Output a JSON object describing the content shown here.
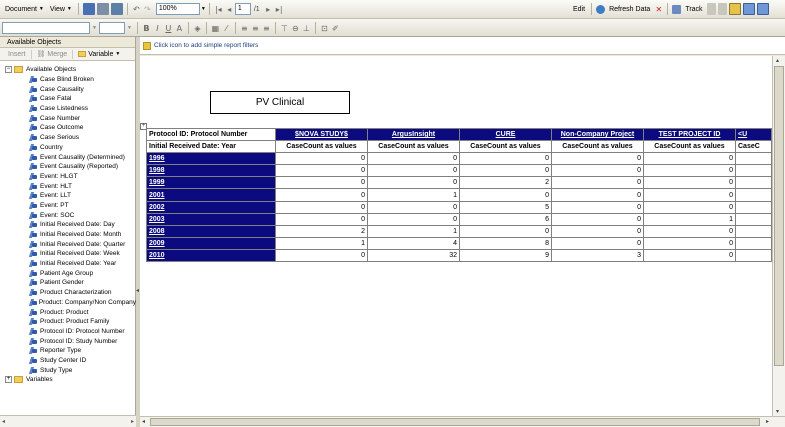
{
  "toolbar": {
    "document_label": "Document",
    "view_label": "View",
    "zoom_value": "100%",
    "page_value": "1",
    "page_of": "/1",
    "edit_label": "Edit",
    "refresh_label": "Refresh Data",
    "track_label": "Track"
  },
  "format_toolbar": {
    "font_value": "",
    "size_value": ""
  },
  "left_panel": {
    "title": "Available Objects",
    "insert_label": "Insert",
    "merge_label": "Merge",
    "variable_label": "Variable",
    "root_label": "Available Objects",
    "objects": [
      "Case Blind Broken",
      "Case Causality",
      "Case Fatal",
      "Case Listedness",
      "Case Number",
      "Case Outcome",
      "Case Serious",
      "Country",
      "Event Causality (Determined)",
      "Event Causality (Reported)",
      "Event: HLGT",
      "Event: HLT",
      "Event: LLT",
      "Event: PT",
      "Event: SOC",
      "Initial Received Date: Day",
      "Initial Received Date: Month",
      "Initial Received Date: Quarter",
      "Initial Received Date: Week",
      "Initial Received Date: Year",
      "Patient Age Group",
      "Patient Gender",
      "Product Characterization",
      "Product: Company/Non Company",
      "Product: Product",
      "Product: Product Family",
      "Protocol ID: Protocol Number",
      "Protocol ID: Study Number",
      "Reporter Type",
      "Study Center ID",
      "Study Type"
    ],
    "variables_label": "Variables"
  },
  "filter_bar": {
    "hint": "Click icon to add simple report filters"
  },
  "report": {
    "title": "PV Clinical",
    "corner_top": "Protocol  ID: Protocol Number",
    "corner_bottom": "Initial Received Date: Year",
    "columns": [
      "$NOVA STUDY$",
      "ArgusInsight",
      "CURE",
      "Non-Company Project",
      "TEST PROJECT ID",
      "<U"
    ],
    "measure_label": "CaseCount as values",
    "measure_label_cut": "CaseC",
    "rows": [
      {
        "year": "1996",
        "values": [
          "0",
          "0",
          "0",
          "0",
          "0"
        ]
      },
      {
        "year": "1998",
        "values": [
          "0",
          "0",
          "0",
          "0",
          "0"
        ]
      },
      {
        "year": "1999",
        "values": [
          "0",
          "0",
          "2",
          "0",
          "0"
        ]
      },
      {
        "year": "2001",
        "values": [
          "0",
          "1",
          "0",
          "0",
          "0"
        ]
      },
      {
        "year": "2002",
        "values": [
          "0",
          "0",
          "5",
          "0",
          "0"
        ]
      },
      {
        "year": "2003",
        "values": [
          "0",
          "0",
          "6",
          "0",
          "1"
        ]
      },
      {
        "year": "2008",
        "values": [
          "2",
          "1",
          "0",
          "0",
          "0"
        ]
      },
      {
        "year": "2009",
        "values": [
          "1",
          "4",
          "8",
          "0",
          "0"
        ]
      },
      {
        "year": "2010",
        "values": [
          "0",
          "32",
          "9",
          "3",
          "0"
        ]
      }
    ]
  },
  "colors": {
    "header_blue": "#0b0b7f",
    "window_bg": "#ece9d8"
  }
}
